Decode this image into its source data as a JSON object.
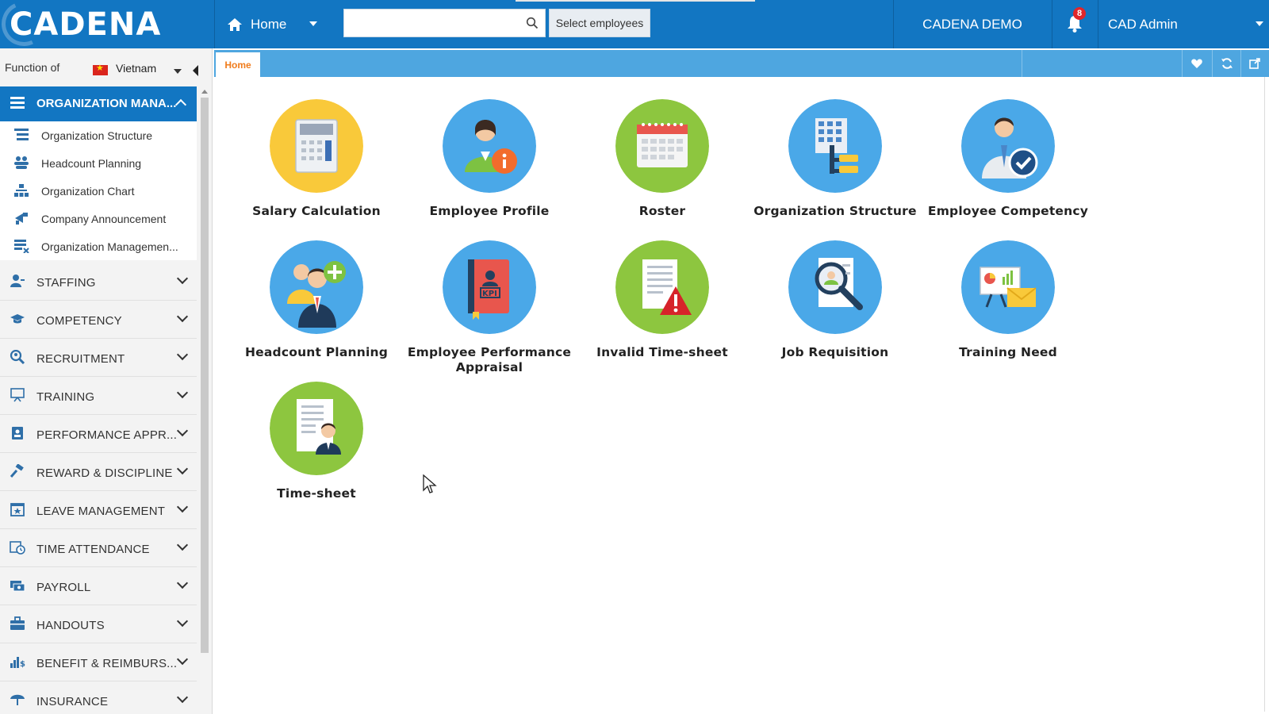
{
  "brand": {
    "logo_text": "CADENA"
  },
  "topbar": {
    "home_label": "Home",
    "search_placeholder": "",
    "select_employees_label": "Select employees",
    "demo_label": "CADENA DEMO",
    "notification_count": "8",
    "user_label": "CAD Admin"
  },
  "sidebar": {
    "function_of_label": "Function of",
    "country": "Vietnam",
    "open_group": {
      "label": "ORGANIZATION MANA...",
      "items": [
        {
          "label": "Organization Structure",
          "icon": "tree-list-icon"
        },
        {
          "label": "Headcount Planning",
          "icon": "people-group-icon"
        },
        {
          "label": "Organization Chart",
          "icon": "org-chart-icon"
        },
        {
          "label": "Company Announcement",
          "icon": "megaphone-icon"
        },
        {
          "label": "Organization Managemen...",
          "icon": "list-settings-icon"
        }
      ]
    },
    "groups": [
      {
        "label": "STAFFING",
        "icon": "person-icon"
      },
      {
        "label": "COMPETENCY",
        "icon": "graduation-cap-icon"
      },
      {
        "label": "RECRUITMENT",
        "icon": "search-person-icon"
      },
      {
        "label": "TRAINING",
        "icon": "presentation-board-icon"
      },
      {
        "label": "PERFORMANCE APPR...",
        "icon": "id-badge-icon"
      },
      {
        "label": "REWARD & DISCIPLINE",
        "icon": "gavel-icon"
      },
      {
        "label": "LEAVE MANAGEMENT",
        "icon": "calendar-star-icon"
      },
      {
        "label": "TIME ATTENDANCE",
        "icon": "calendar-clock-icon"
      },
      {
        "label": "PAYROLL",
        "icon": "money-icon"
      },
      {
        "label": "HANDOUTS",
        "icon": "briefcase-icon"
      },
      {
        "label": "BENEFIT & REIMBURS...",
        "icon": "chart-dollar-icon"
      },
      {
        "label": "INSURANCE",
        "icon": "umbrella-icon"
      }
    ]
  },
  "tabs": {
    "active": "Home"
  },
  "tiles": [
    {
      "label": "Salary Calculation",
      "icon": "calculator-icon",
      "color": "#f9c93a"
    },
    {
      "label": "Employee Profile",
      "icon": "employee-info-icon",
      "color": "#4aa8e8"
    },
    {
      "label": "Roster",
      "icon": "calendar-icon",
      "color": "#8dc63f"
    },
    {
      "label": "Organization Structure",
      "icon": "building-structure-icon",
      "color": "#4aa8e8"
    },
    {
      "label": "Employee Competency",
      "icon": "employee-check-icon",
      "color": "#4aa8e8"
    },
    {
      "label": "Headcount Planning",
      "icon": "add-people-icon",
      "color": "#4aa8e8"
    },
    {
      "label": "Employee Performance Appraisal",
      "icon": "kpi-book-icon",
      "color": "#4aa8e8"
    },
    {
      "label": "Invalid Time-sheet",
      "icon": "document-warning-icon",
      "color": "#8dc63f"
    },
    {
      "label": "Job Requisition",
      "icon": "magnifier-resume-icon",
      "color": "#4aa8e8"
    },
    {
      "label": "Training Need",
      "icon": "presentation-mail-icon",
      "color": "#4aa8e8"
    },
    {
      "label": "Time-sheet",
      "icon": "timesheet-person-icon",
      "color": "#8dc63f"
    }
  ]
}
